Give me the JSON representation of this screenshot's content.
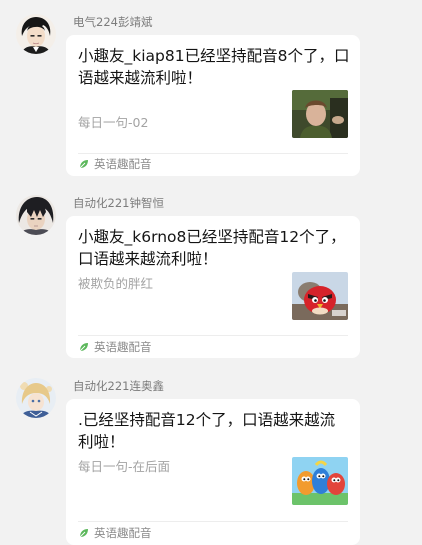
{
  "feed": {
    "posts": [
      {
        "username": "电气224彭靖斌",
        "message": "小趣友_kiap81已经坚持配音8个了，口语越来越流利啦！",
        "subtitle": "每日一句-02",
        "source_label": "英语趣配音",
        "avatar_icon": "anime-avatar-icon",
        "thumbnail": "movie-scene-thumbnail"
      },
      {
        "username": "自动化221钟智恒",
        "message": "小趣友_k6rno8已经坚持配音12个了，口语越来越流利啦！",
        "subtitle": "被欺负的胖红",
        "source_label": "英语趣配音",
        "avatar_icon": "anime-avatar-icon",
        "thumbnail": "angry-bird-thumbnail"
      },
      {
        "username": "自动化221连奥鑫",
        "message": ".已经坚持配音12个了，口语越来越流利啦！",
        "subtitle": "每日一句-在后面",
        "source_label": "英语趣配音",
        "avatar_icon": "anime-avatar-icon",
        "thumbnail": "cartoon-characters-thumbnail"
      }
    ]
  },
  "colors": {
    "page_background": "#f2f2f2",
    "card_background": "#ffffff",
    "username_text": "#7c7c7c",
    "subtitle_text": "#a3a3a3",
    "source_icon": "#5cb85c"
  }
}
